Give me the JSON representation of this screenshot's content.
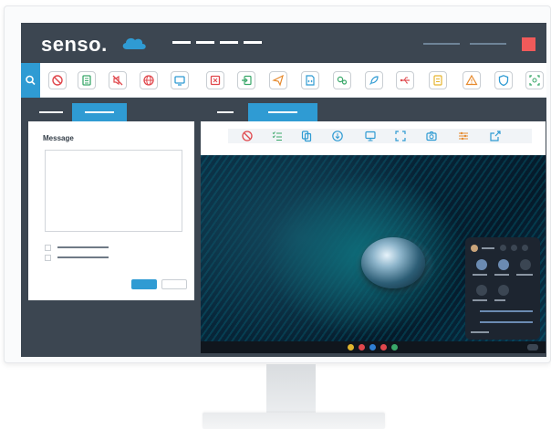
{
  "brand": {
    "name": "senso.",
    "cloud_color": "#2f9bd3",
    "cloud_icon": "cloud-icon"
  },
  "colors": {
    "topbar": "#3c4651",
    "accent": "#2f9bd3",
    "close_square": "#f05a5a"
  },
  "toolbar": {
    "search_icon": "search-icon",
    "tools": [
      {
        "name": "block-icon",
        "color": "#e0474c"
      },
      {
        "name": "list-document-icon",
        "color": "#3aa86a"
      },
      {
        "name": "mute-icon",
        "color": "#e0474c"
      },
      {
        "name": "globe-icon",
        "color": "#e0474c"
      },
      {
        "name": "screen-share-icon",
        "color": "#2f9bd3"
      },
      {
        "name": "close-window-icon",
        "color": "#e0474c"
      },
      {
        "name": "login-icon",
        "color": "#3aa86a"
      },
      {
        "name": "send-icon",
        "color": "#e68a2e"
      },
      {
        "name": "document-code-icon",
        "color": "#2f9bd3"
      },
      {
        "name": "settings-cog-icon",
        "color": "#3aa86a"
      },
      {
        "name": "rocket-icon",
        "color": "#2f9bd3"
      },
      {
        "name": "usb-icon",
        "color": "#e0474c"
      },
      {
        "name": "notes-icon",
        "color": "#e6b52e"
      },
      {
        "name": "warning-icon",
        "color": "#e68a2e"
      },
      {
        "name": "shield-icon",
        "color": "#2f9bd3"
      },
      {
        "name": "scan-icon",
        "color": "#3aa86a"
      }
    ]
  },
  "message_panel": {
    "label": "Message",
    "message_value": ""
  },
  "remote_toolbar": {
    "tools": [
      {
        "name": "no-draw-icon",
        "color": "#e0474c"
      },
      {
        "name": "checklist-icon",
        "color": "#3aa86a"
      },
      {
        "name": "copy-icon",
        "color": "#2f9bd3"
      },
      {
        "name": "download-icon",
        "color": "#2f9bd3"
      },
      {
        "name": "monitor-icon",
        "color": "#2f9bd3"
      },
      {
        "name": "fit-screen-icon",
        "color": "#2f9bd3"
      },
      {
        "name": "camera-icon",
        "color": "#2f9bd3"
      },
      {
        "name": "sliders-icon",
        "color": "#e68a2e"
      },
      {
        "name": "export-icon",
        "color": "#2f9bd3"
      }
    ]
  }
}
